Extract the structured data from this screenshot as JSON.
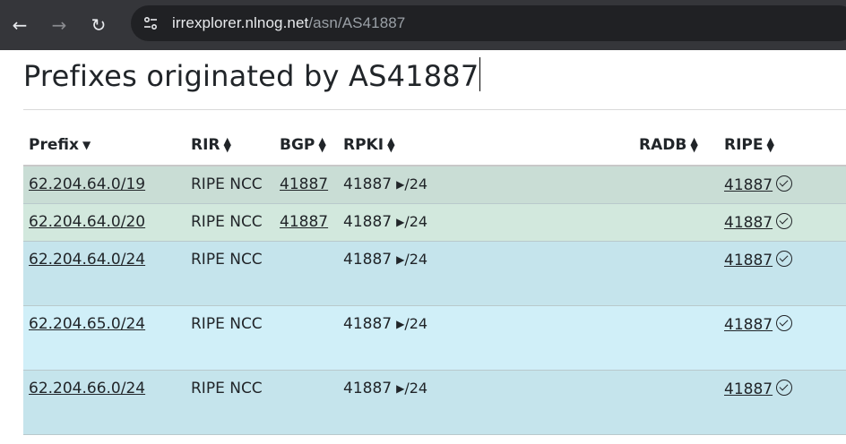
{
  "browser": {
    "url_host": "irrexplorer.nlnog.net",
    "url_path": "/asn/AS41887"
  },
  "page": {
    "title": "Prefixes originated by AS41887"
  },
  "table": {
    "headers": {
      "prefix": "Prefix",
      "rir": "RIR",
      "bgp": "BGP",
      "rpki": "RPKI",
      "radb": "RADB",
      "ripe": "RIPE"
    },
    "rows": [
      {
        "prefix": "62.204.64.0/19",
        "rir": "RIPE NCC",
        "bgp": "41887",
        "rpki_asn": "41887",
        "rpki_len": "/24",
        "ripe": "41887",
        "bg": "#c9ddd5"
      },
      {
        "prefix": "62.204.64.0/20",
        "rir": "RIPE NCC",
        "bgp": "41887",
        "rpki_asn": "41887",
        "rpki_len": "/24",
        "ripe": "41887",
        "bg": "#d2e8dd"
      },
      {
        "prefix": "62.204.64.0/24",
        "rir": "RIPE NCC",
        "bgp": "",
        "rpki_asn": "41887",
        "rpki_len": "/24",
        "ripe": "41887",
        "bg": "#c5e4ec"
      },
      {
        "prefix": "62.204.65.0/24",
        "rir": "RIPE NCC",
        "bgp": "",
        "rpki_asn": "41887",
        "rpki_len": "/24",
        "ripe": "41887",
        "bg": "#d0eff8"
      },
      {
        "prefix": "62.204.66.0/24",
        "rir": "RIPE NCC",
        "bgp": "",
        "rpki_asn": "41887",
        "rpki_len": "/24",
        "ripe": "41887",
        "bg": "#c5e4ec"
      }
    ]
  },
  "colors": {
    "topbar": "#35363a",
    "urlbar": "#202124"
  }
}
